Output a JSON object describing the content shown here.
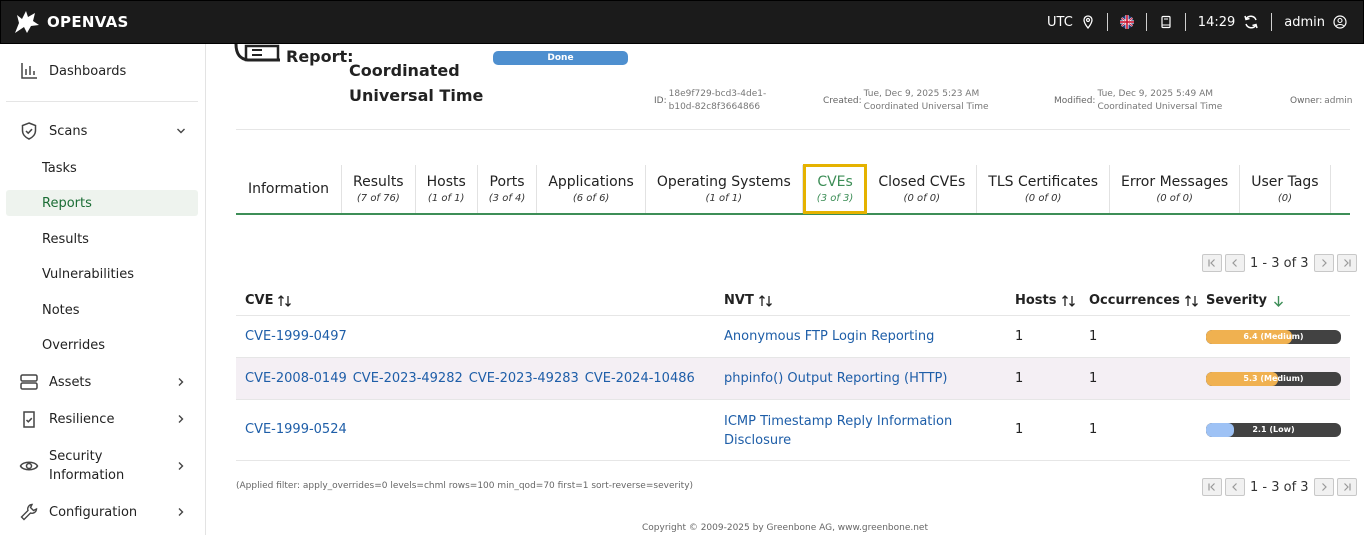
{
  "topbar": {
    "brand": "OPENVAS",
    "timezone": "UTC",
    "time": "14:29",
    "user": "admin"
  },
  "sidebar": {
    "items": [
      {
        "label": "Dashboards"
      },
      {
        "label": "Scans"
      },
      {
        "label": "Tasks"
      },
      {
        "label": "Reports"
      },
      {
        "label": "Results"
      },
      {
        "label": "Vulnerabilities"
      },
      {
        "label": "Notes"
      },
      {
        "label": "Overrides"
      },
      {
        "label": "Assets"
      },
      {
        "label": "Resilience"
      },
      {
        "label": "Security Information"
      },
      {
        "label": "Configuration"
      }
    ]
  },
  "report": {
    "label": "Report:",
    "title": "Coordinated Universal Time",
    "status": "Done",
    "id_label": "ID:",
    "id_value": "18e9f729-bcd3-4de1-b10d-82c8f3664866",
    "created_label": "Created:",
    "created_value": "Tue, Dec 9, 2025 5:23 AM Coordinated Universal Time",
    "modified_label": "Modified:",
    "modified_value": "Tue, Dec 9, 2025 5:49 AM Coordinated Universal Time",
    "owner_label": "Owner:",
    "owner_value": "admin"
  },
  "tabs": [
    {
      "label": "Information",
      "count": ""
    },
    {
      "label": "Results",
      "count": "(7 of 76)"
    },
    {
      "label": "Hosts",
      "count": "(1 of 1)"
    },
    {
      "label": "Ports",
      "count": "(3 of 4)"
    },
    {
      "label": "Applications",
      "count": "(6 of 6)"
    },
    {
      "label": "Operating Systems",
      "count": "(1 of 1)"
    },
    {
      "label": "CVEs",
      "count": "(3 of 3)"
    },
    {
      "label": "Closed CVEs",
      "count": "(0 of 0)"
    },
    {
      "label": "TLS Certificates",
      "count": "(0 of 0)"
    },
    {
      "label": "Error Messages",
      "count": "(0 of 0)"
    },
    {
      "label": "User Tags",
      "count": "(0)"
    }
  ],
  "pagination": {
    "text": "1 - 3 of 3"
  },
  "table": {
    "columns": {
      "cve": "CVE",
      "nvt": "NVT",
      "hosts": "Hosts",
      "occurrences": "Occurrences",
      "severity": "Severity"
    },
    "rows": [
      {
        "cves": [
          "CVE-1999-0497"
        ],
        "nvt": "Anonymous FTP Login Reporting",
        "hosts": "1",
        "occurrences": "1",
        "severity_value": 6.4,
        "severity_label": "6.4 (Medium)",
        "severity_color": "#f0b150"
      },
      {
        "cves": [
          "CVE-2008-0149",
          "CVE-2023-49282",
          "CVE-2023-49283",
          "CVE-2024-10486"
        ],
        "nvt": "phpinfo() Output Reporting (HTTP)",
        "hosts": "1",
        "occurrences": "1",
        "severity_value": 5.3,
        "severity_label": "5.3 (Medium)",
        "severity_color": "#f0b150"
      },
      {
        "cves": [
          "CVE-1999-0524"
        ],
        "nvt": "ICMP Timestamp Reply Information Disclosure",
        "hosts": "1",
        "occurrences": "1",
        "severity_value": 2.1,
        "severity_label": "2.1 (Low)",
        "severity_color": "#9ec2f5"
      }
    ]
  },
  "filter": "(Applied filter: apply_overrides=0 levels=chml rows=100 min_qod=70 first=1 sort-reverse=severity)",
  "copyright": "Copyright © 2009-2025 by Greenbone AG, www.greenbone.net"
}
